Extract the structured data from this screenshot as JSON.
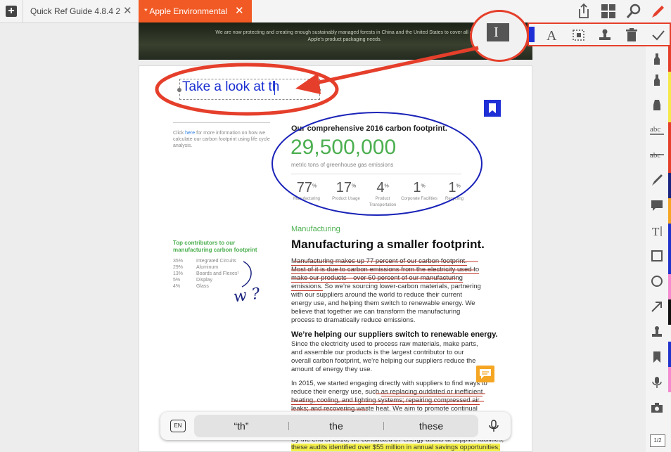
{
  "tabs": [
    {
      "label": "Quick Ref Guide 4.8.4 2",
      "active": false
    },
    {
      "label": "* Apple Environmental",
      "active": true
    }
  ],
  "top_icons": [
    "share-icon",
    "grid-icon",
    "search-icon",
    "pen-icon"
  ],
  "annotation_bar": [
    "text-cursor-icon",
    "font-icon",
    "transform-icon",
    "stamp-icon",
    "trash-icon",
    "check-icon"
  ],
  "tools": [
    {
      "icon": "highlighter-red-icon",
      "color": "#e53f2b"
    },
    {
      "icon": "highlighter-yellow-icon",
      "color": "#f5e94a"
    },
    {
      "icon": "highlighter-icon",
      "color": "#f5e94a"
    },
    {
      "icon": "underline-abc-icon",
      "color": "#e53f2b"
    },
    {
      "icon": "strikethrough-abc-icon",
      "color": "#e53f2b"
    },
    {
      "icon": "pen-icon",
      "color": "#1a237e"
    },
    {
      "icon": "comment-icon",
      "color": "#f5a623"
    },
    {
      "icon": "text-box-icon",
      "color": "#2233cc"
    },
    {
      "icon": "rectangle-icon",
      "color": "#2233cc"
    },
    {
      "icon": "circle-icon",
      "color": "#f58ad0"
    },
    {
      "icon": "arrow-icon",
      "color": "#111111"
    },
    {
      "icon": "stamp-icon",
      "color": "#ffffff"
    },
    {
      "icon": "bookmark-icon",
      "color": "#2233cc"
    },
    {
      "icon": "microphone-icon",
      "color": "#f58ad0"
    },
    {
      "icon": "camera-icon",
      "color": "#ffffff"
    }
  ],
  "page_indicator": "1/2",
  "header_text": "We are now protecting and creating enough sustainably managed forests in China and the United States to cover all of Apple’s product packaging needs.",
  "typed_text": "Take a look at th",
  "sidebar_note": {
    "pre": "Click ",
    "link": "here",
    "post": " for more information on how we calculate our carbon footprint using life cycle analysis."
  },
  "footprint": {
    "heading": "Our comprehensive 2016 carbon footprint.",
    "value": "29,500,000",
    "unit": "metric tons of greenhouse gas emissions",
    "breakdown": [
      {
        "pct": "77",
        "label": "Manufacturing"
      },
      {
        "pct": "17",
        "label": "Product Usage"
      },
      {
        "pct": "4",
        "label": "Product Transportation"
      },
      {
        "pct": "1",
        "label": "Corporate Facilities"
      },
      {
        "pct": "1",
        "label": "Recycling"
      }
    ]
  },
  "contributors": {
    "title": "Top contributors to our manufacturing carbon footprint",
    "items": [
      {
        "pct": "35%",
        "label": "Integrated Circuits"
      },
      {
        "pct": "29%",
        "label": "Aluminum"
      },
      {
        "pct": "13%",
        "label": "Boards and Flexes¹"
      },
      {
        "pct": "5%",
        "label": "Display"
      },
      {
        "pct": "4%",
        "label": "Glass"
      }
    ]
  },
  "handwriting": "w ?",
  "section": {
    "kicker": "Manufacturing",
    "title": "Manufacturing a smaller footprint.",
    "p1_underlined": "Manufacturing makes up 77 percent of our carbon footprint. Most of it is due to carbon emissions from the electricity used to make our products—over 60 percent of our manufacturing emissions.",
    "p1_rest": " So we’re sourcing lower-carbon materials, partnering with our suppliers around the world to reduce their current energy use, and helping them switch to renewable energy. We believe that together we can transform the manufacturing process to dramatically reduce emissions.",
    "subtitle": "We’re helping our suppliers switch to renewable energy.",
    "p2": "Since the electricity used to process raw materials, make parts, and assemble our products is the largest contributor to our overall carbon footprint, we’re helping our suppliers reduce the amount of energy they use.",
    "p3_a": "In 2015, we started engaging directly with suppliers to find ways to reduce their energy use, such ",
    "p3_underlined": "as replacing outdated or inefficient heating, cooling, and lighting systems; repairing compressed air leaks; and recovering waste heat.",
    "p3_b": " We aim to promote continual improvement,",
    "p4": "By the end of 2016, we conducted 67 energy audits at supplier facilities;",
    "p5_highlight": "these audits identified over $55 million in annual savings opportunities;"
  },
  "suggestions": [
    "“th”",
    "the",
    "these"
  ],
  "keyboard_lang": "EN"
}
